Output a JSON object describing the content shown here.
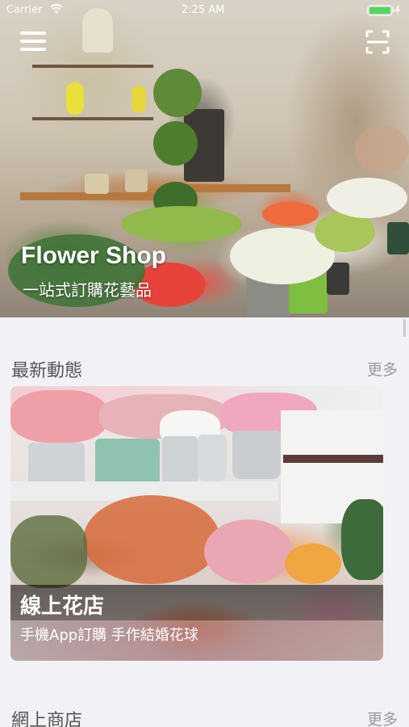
{
  "status_bar": {
    "carrier": "Carrier",
    "time": "2:25 AM",
    "battery_color": "#4cd964"
  },
  "hero": {
    "title": "Flower Shop",
    "subtitle": "一站式訂購花藝品",
    "menu_icon": "hamburger-menu-icon",
    "scan_icon": "qr-scan-icon"
  },
  "sections": [
    {
      "title": "最新動態",
      "more_label": "更多",
      "card": {
        "title": "線上花店",
        "subtitle": "手機App訂購 手作結婚花球"
      }
    },
    {
      "title": "網上商店",
      "more_label": "更多"
    }
  ]
}
